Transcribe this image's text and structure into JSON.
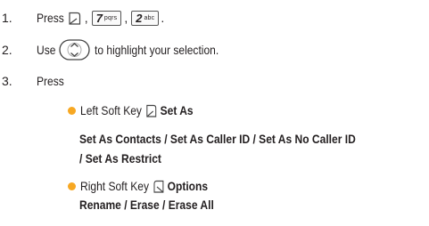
{
  "steps": [
    {
      "num": "1.",
      "text": "Press",
      "comma": ",",
      "period": "."
    },
    {
      "num": "2.",
      "text_before": "Use",
      "text_after": "to highlight your selection."
    },
    {
      "num": "3.",
      "text": "Press"
    }
  ],
  "keys": {
    "key7": {
      "digit": "7",
      "letters": "pqrs"
    },
    "key2": {
      "digit": "2",
      "letters": "abc"
    }
  },
  "options": [
    {
      "lead": "Left Soft Key",
      "label": "Set As",
      "details": [
        "Set As Contacts / Set As Caller ID / Set As No Caller ID",
        "/ Set As Restrict"
      ]
    },
    {
      "lead": "Right Soft Key",
      "label": "Options",
      "details": [
        "Rename / Erase / Erase All"
      ]
    }
  ],
  "colors": {
    "bullet": "#f7a823",
    "text": "#231f20"
  },
  "icons": {
    "left_soft_key": "left-soft-key-icon",
    "right_soft_key": "right-soft-key-icon",
    "navigation_key": "navigation-key-icon"
  }
}
